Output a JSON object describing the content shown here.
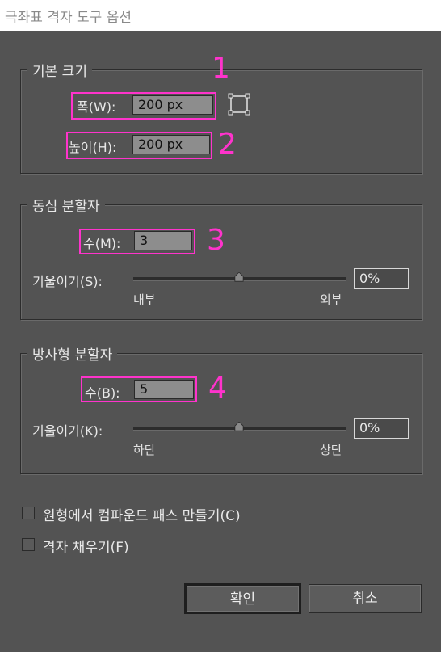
{
  "window": {
    "title": "극좌표 격자 도구 옵션"
  },
  "default_size": {
    "title": "기본 크기",
    "width_label": "폭(W):",
    "width_value": "200 px",
    "height_label": "높이(H):",
    "height_value": "200 px",
    "reference_point_icon": "anchor-square-icon"
  },
  "concentric": {
    "title": "동심 분할자",
    "count_label": "수(M):",
    "count_value": "3",
    "skew_label": "기울이기(S):",
    "skew_value": "0%",
    "skew_level": 0.5,
    "min_label": "내부",
    "max_label": "외부"
  },
  "radial": {
    "title": "방사형 분할자",
    "count_label": "수(B):",
    "count_value": "5",
    "skew_label": "기울이기(K):",
    "skew_value": "0%",
    "skew_level": 0.5,
    "min_label": "하단",
    "max_label": "상단"
  },
  "options": {
    "compound_path_label": "원형에서 컴파운드 패스 만들기(C)",
    "compound_path_checked": false,
    "fill_grid_label": "격자 채우기(F)",
    "fill_grid_checked": false
  },
  "buttons": {
    "ok": "확인",
    "cancel": "취소"
  },
  "annotations": {
    "n1": "1",
    "n2": "2",
    "n3": "3",
    "n4": "4",
    "color": "#ff33cc"
  }
}
